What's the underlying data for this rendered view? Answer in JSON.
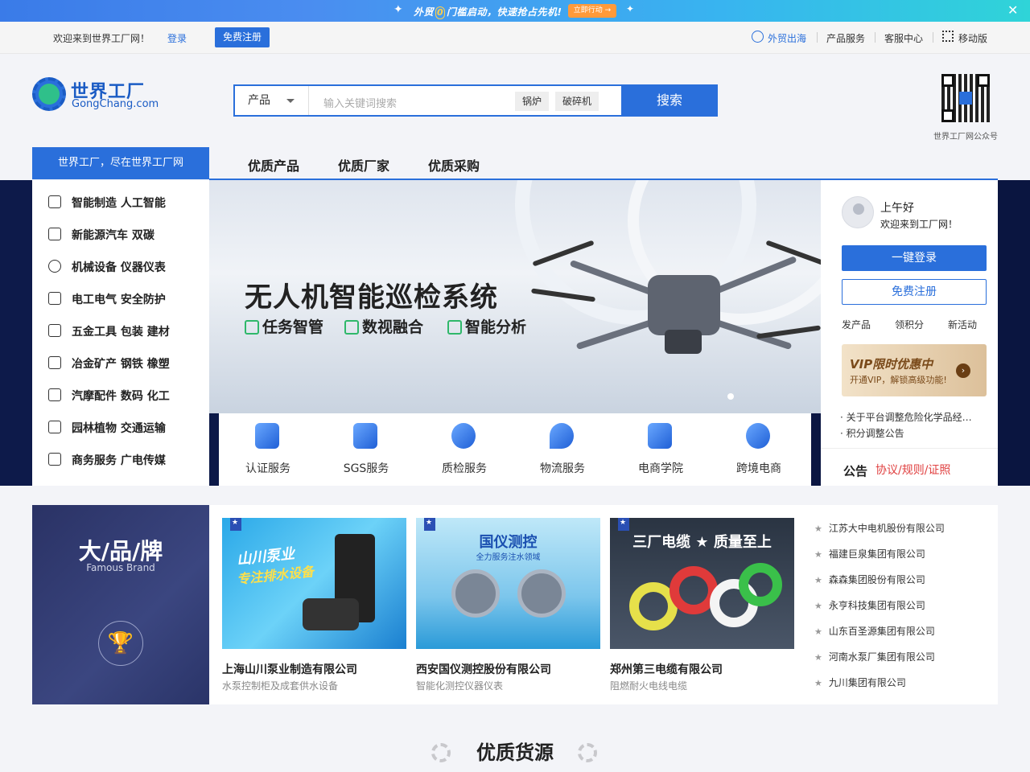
{
  "promo": {
    "text_prefix": "外贸",
    "text_zero": "0",
    "text_suffix": "门槛启动，快速抢占先机!",
    "button": "立即行动 →",
    "close": "✕"
  },
  "topbar": {
    "welcome": "欢迎来到世界工厂网！",
    "login": "登录",
    "register": "免费注册",
    "links": [
      "外贸出海",
      "产品服务",
      "客服中心",
      "移动版"
    ]
  },
  "logo": {
    "cn": "世界工厂",
    "en": "GongChang.com"
  },
  "search": {
    "category": "产品",
    "placeholder": "输入关键词搜索",
    "hot_tags": [
      "锅炉",
      "破碎机"
    ],
    "button": "搜索"
  },
  "qr": {
    "label": "世界工厂网公众号"
  },
  "nav": {
    "slogan": "世界工厂，尽在世界工厂网",
    "links": [
      "优质产品",
      "优质厂家",
      "优质采购"
    ]
  },
  "categories": [
    "智能制造  人工智能",
    "新能源汽车  双碳",
    "机械设备  仪器仪表",
    "电工电气  安全防护",
    "五金工具  包装  建材",
    "冶金矿产  钢铁  橡塑",
    "汽摩配件  数码  化工",
    "园林植物  交通运输",
    "商务服务  广电传媒"
  ],
  "banner": {
    "title": "无人机智能巡检系统",
    "features": [
      "任务智管",
      "数视融合",
      "智能分析"
    ]
  },
  "services": [
    "认证服务",
    "SGS服务",
    "质检服务",
    "物流服务",
    "电商学院",
    "跨境电商"
  ],
  "user": {
    "greeting": "上午好",
    "welcome": "欢迎来到工厂网！",
    "login_btn": "一键登录",
    "register_btn": "免费注册",
    "quick": [
      "发产品",
      "领积分",
      "新活动"
    ],
    "vip_title": "VIP限时优惠中",
    "vip_sub": "开通VIP，解锁高级功能!",
    "vip_go": "›",
    "announcements": [
      "关于平台调整危险化学品经…",
      "积分调整公告"
    ],
    "notice_label": "公告",
    "notice_links": "协议/规则/证照"
  },
  "brand": {
    "title": "大/品/牌",
    "subtitle": "Famous Brand",
    "trophy": "🏆",
    "cards": [
      {
        "name": "上海山川泵业制造有限公司",
        "desc": "水泵控制柜及成套供水设备",
        "img_text1": "山川泵业",
        "img_text2": "专注排水设备"
      },
      {
        "name": "西安国仪测控股份有限公司",
        "desc": "智能化测控仪器仪表",
        "img_text1": "国仪测控",
        "img_text2": "全力服务注水领域"
      },
      {
        "name": "郑州第三电缆有限公司",
        "desc": "阻燃耐火电线电缆",
        "img_text1": "三厂电缆 ★ 质量至上",
        "img_text2": ""
      }
    ],
    "list": [
      "江苏大中电机股份有限公司",
      "福建巨泉集团有限公司",
      "森森集团股份有限公司",
      "永亨科技集团有限公司",
      "山东百圣源集团有限公司",
      "河南水泵厂集团有限公司",
      "九川集团有限公司"
    ]
  },
  "section": {
    "title": "优质货源"
  },
  "colors": {
    "primary": "#2a6fdb",
    "accent_red": "#e04040",
    "brand_dark": "#2a3265"
  }
}
